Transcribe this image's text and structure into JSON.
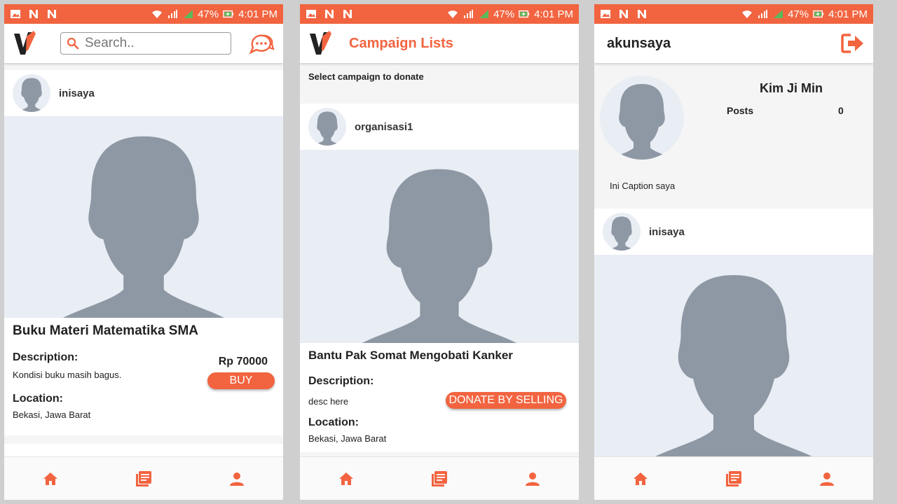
{
  "status_bar": {
    "battery": "47%",
    "time": "4:01 PM"
  },
  "colors": {
    "accent": "#f26440",
    "placeholder_bg": "#e9edf4",
    "silhouette": "#8e98a5"
  },
  "screen1": {
    "search_placeholder": "Search..",
    "post": {
      "username": "inisaya",
      "title": "Buku Materi Matematika SMA",
      "description_label": "Description:",
      "price": "Rp 70000",
      "description": "Kondisi buku masih bagus.",
      "buy_label": "BUY",
      "location_label": "Location:",
      "location": "Bekasi, Jawa Barat"
    }
  },
  "screen2": {
    "title": "Campaign Lists",
    "subtitle": "Select campaign to donate",
    "campaign": {
      "username": "organisasi1",
      "title": "Bantu Pak Somat Mengobati Kanker",
      "description_label": "Description:",
      "description": "desc here",
      "donate_label": "DONATE BY SELLING",
      "location_label": "Location:",
      "location": "Bekasi, Jawa Barat"
    }
  },
  "screen3": {
    "username": "akunsaya",
    "name": "Kim Ji Min",
    "posts_label": "Posts",
    "posts_count": "0",
    "caption": "Ini Caption saya",
    "post_username": "inisaya"
  },
  "bottom_nav": [
    "home-icon",
    "list-icon",
    "profile-icon"
  ]
}
